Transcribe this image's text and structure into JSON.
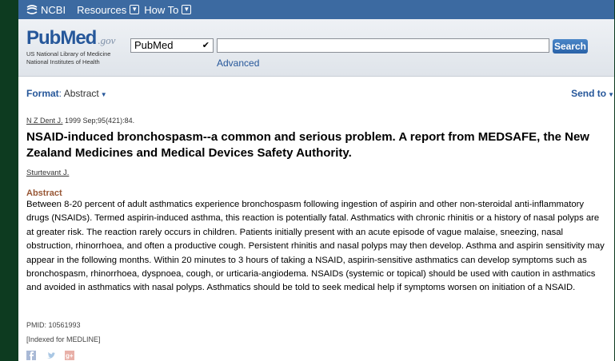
{
  "ncbi": {
    "logo": "NCBI",
    "nav": [
      "Resources",
      "How To"
    ]
  },
  "pubmed": {
    "logo_word": "PubMed",
    "logo_gov": ".gov",
    "nlm_line1": "US National Library of Medicine",
    "nlm_line2": "National Institutes of Health"
  },
  "search": {
    "database": "PubMed",
    "query": "",
    "button": "Search",
    "advanced": "Advanced"
  },
  "format": {
    "label": "Format",
    "value": "Abstract"
  },
  "send_to": "Send to",
  "article": {
    "journal": "N Z Dent J.",
    "citation": " 1999 Sep;95(421):84.",
    "title": "NSAID-induced bronchospasm--a common and serious problem. A report from MEDSAFE, the New Zealand Medicines and Medical Devices Safety Authority.",
    "author": "Sturtevant J.",
    "abstract_heading": "Abstract",
    "abstract": "Between 8-20 percent of adult asthmatics experience bronchospasm following ingestion of aspirin and other non-steroidal anti-inflammatory drugs (NSAIDs). Termed aspirin-induced asthma, this reaction is potentially fatal. Asthmatics with chronic rhinitis or a history of nasal polyps are at greater risk. The reaction rarely occurs in children. Patients initially present with an acute episode of vague malaise, sneezing, nasal obstruction, rhinorrhoea, and often a productive cough. Persistent rhinitis and nasal polyps may then develop. Asthma and aspirin sensitivity may appear in the following months. Within 20 minutes to 3 hours of taking a NSAID, aspirin-sensitive asthmatics can develop symptoms such as bronchospasm, rhinorrhoea, dyspnoea, cough, or urticaria-angiodema. NSAIDs (systemic or topical) should be used with caution in asthmatics and avoided in asthmatics with nasal polyps. Asthmatics should be told to seek medical help if symptoms worsen on initiation of a NSAID.",
    "pmid": "PMID: 10561993",
    "indexed": "[Indexed for MEDLINE]"
  },
  "colors": {
    "ncbi_bar": "#3c6aa1",
    "link": "#26579a",
    "abstract_heading": "#985735",
    "background": "#0d3b20"
  },
  "social_icons": [
    "facebook-icon",
    "twitter-icon",
    "google-plus-icon"
  ]
}
